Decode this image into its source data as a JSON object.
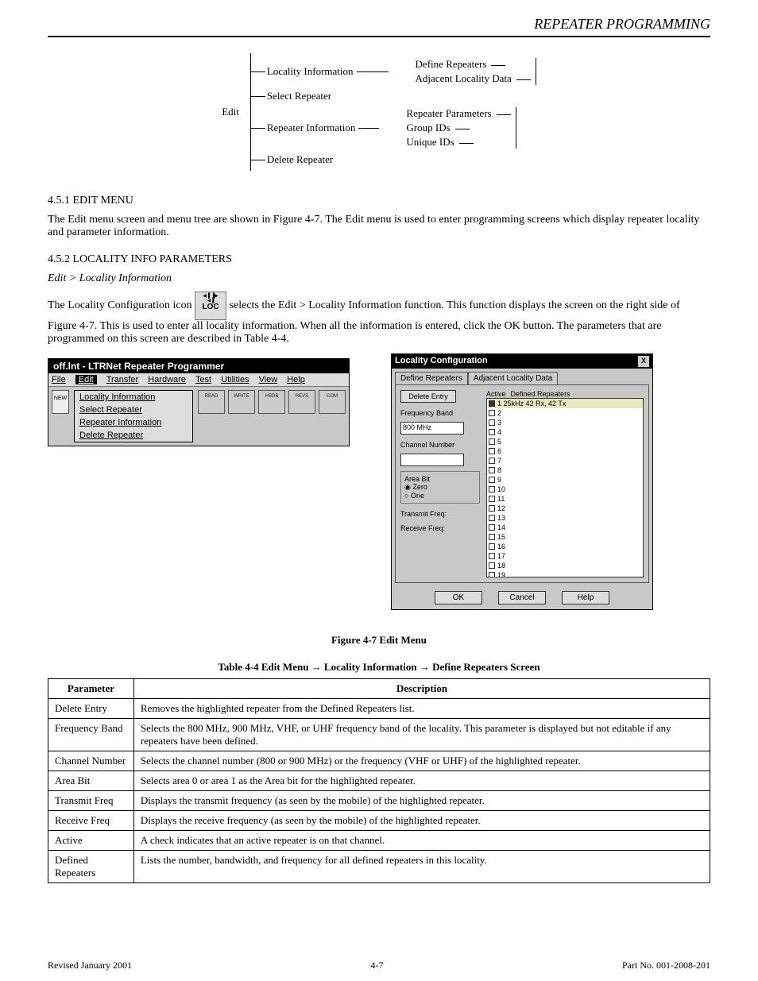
{
  "header": {
    "title": "REPEATER PROGRAMMING"
  },
  "tree": {
    "root": "Edit",
    "n1": "Locality Information",
    "n1a": "Define Repeaters",
    "n1b": "Adjacent Locality Data",
    "n2": "Select Repeater",
    "n3": "Repeater Information",
    "n3a": "Repeater Parameters",
    "n3b": "Group IDs",
    "n3c": "Unique IDs",
    "n4": "Delete Repeater"
  },
  "h_editmenu": "4.5.1 EDIT MENU",
  "p_edit1": "The Edit menu screen and menu tree are shown in Figure 4-7. The Edit menu is used to enter programming screens which display repeater locality and parameter information.",
  "h_locality": "4.5.2 LOCALITY INFO PARAMETERS",
  "ital": "Edit > Locality Information",
  "p_loc_prefix": "The Locality Configuration icon",
  "p_loc_suffix": "selects the Edit > Locality Information function. This function displays the screen on the right side of Figure 4-7. This is used to enter all locality information. When all the information is entered, click the OK button. The parameters that are programmed on this screen are described in Table 4-4.",
  "icon": {
    "top": "◀▐ ▐▶",
    "mid": "◀▐",
    "label": "LOC"
  },
  "menuwin": {
    "title": "off.lnt - LTRNet Repeater Programmer",
    "menubar": [
      "File",
      "Edit",
      "Transfer",
      "Hardware",
      "Test",
      "Utilities",
      "View",
      "Help"
    ],
    "dropdown": [
      "Locality Information",
      "Select Repeater",
      "Repeater Information",
      "Delete Repeater"
    ],
    "tbtn_new": "NEW",
    "tbtn_read": "READ",
    "tbtn_write": "WRITE",
    "tbtn_hsdb": "HSDB",
    "tbtn_revs": "REVS",
    "tbtn_com": "COM"
  },
  "dlg": {
    "title": "Locality Configuration",
    "x": "X",
    "tab1": "Define Repeaters",
    "tab2": "Adjacent Locality Data",
    "deleteEntry": "Delete Entry",
    "freqBand": "Frequency Band",
    "freqBandVal": "800 MHz",
    "chanNum": "Channel Number",
    "areaBit": "Area Bit",
    "rZero": "Zero",
    "rOne": "One",
    "txFreq": "Transmit Freq:",
    "rxFreq": "Receive Freq:",
    "colActive": "Active",
    "colDefined": "Defined Repeaters",
    "row1": "1    25kHz    42 Rx, 42 Tx",
    "ok": "OK",
    "cancel": "Cancel",
    "help": "Help"
  },
  "fig_caption_left": "Figure 4-7   Edit Menu",
  "tableTitle": "Table 4-4   Edit Menu → Locality Information → Define Repeaters Screen",
  "table": {
    "head": [
      "Parameter",
      "Description"
    ],
    "rows": [
      [
        "Delete Entry",
        "Removes the highlighted repeater from the Defined Repeaters list."
      ],
      [
        "Frequency Band",
        "Selects the 800 MHz, 900 MHz, VHF, or UHF frequency band of the locality. This parameter is displayed but not editable if any repeaters have been defined."
      ],
      [
        "Channel Number",
        "Selects the channel number (800 or 900 MHz) or the frequency (VHF or UHF) of the highlighted repeater."
      ],
      [
        "Area Bit",
        "Selects area 0 or area 1 as the Area bit for the highlighted repeater."
      ],
      [
        "Transmit Freq",
        "Displays the transmit frequency (as seen by the mobile) of the highlighted repeater."
      ],
      [
        "Receive Freq",
        "Displays the receive frequency (as seen by the mobile) of the highlighted repeater."
      ],
      [
        "Active",
        "A check indicates that an active repeater is on that channel."
      ],
      [
        "Defined Repeaters",
        "Lists the number, bandwidth, and frequency for all defined repeaters in this locality."
      ]
    ]
  },
  "footer": {
    "rev": "Revised January 2001",
    "page": "4-7",
    "part": "Part No. 001-2008-201"
  }
}
